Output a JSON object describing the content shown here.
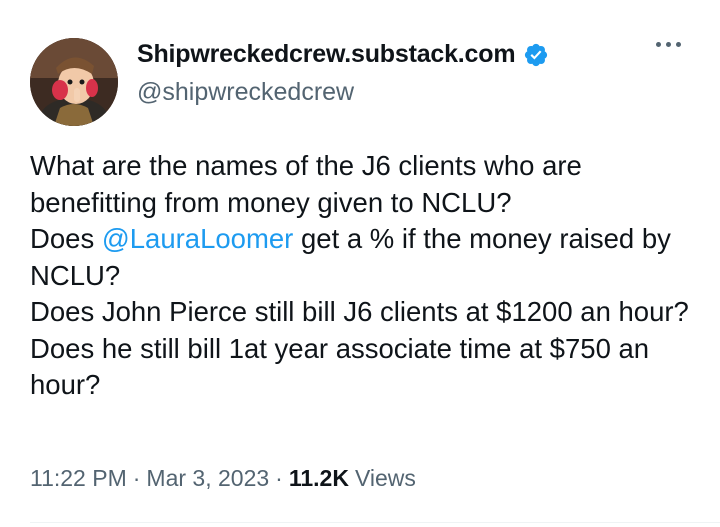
{
  "author": {
    "display_name": "Shipwreckedcrew.substack.com",
    "handle": "@shipwreckedcrew",
    "verified": true,
    "avatar_icon": "cartoon-character-avatar"
  },
  "tweet": {
    "line1": "What are the names of the J6 clients who are benefitting from money given to NCLU?",
    "line2_before": "Does ",
    "line2_mention": "@LauraLoomer",
    "line2_after": " get a % if the money raised by NCLU?",
    "line3": "Does John Pierce still bill J6 clients at $1200 an hour?",
    "line4": "Does he still bill 1at year associate time at $750 an hour?"
  },
  "meta": {
    "time": "11:22 PM",
    "separator": "·",
    "date": "Mar 3, 2023",
    "views_count": "11.2K",
    "views_label": "Views"
  },
  "colors": {
    "text": "#0f1419",
    "secondary": "#536471",
    "link": "#1d9bf0",
    "verified": "#1d9bf0"
  }
}
